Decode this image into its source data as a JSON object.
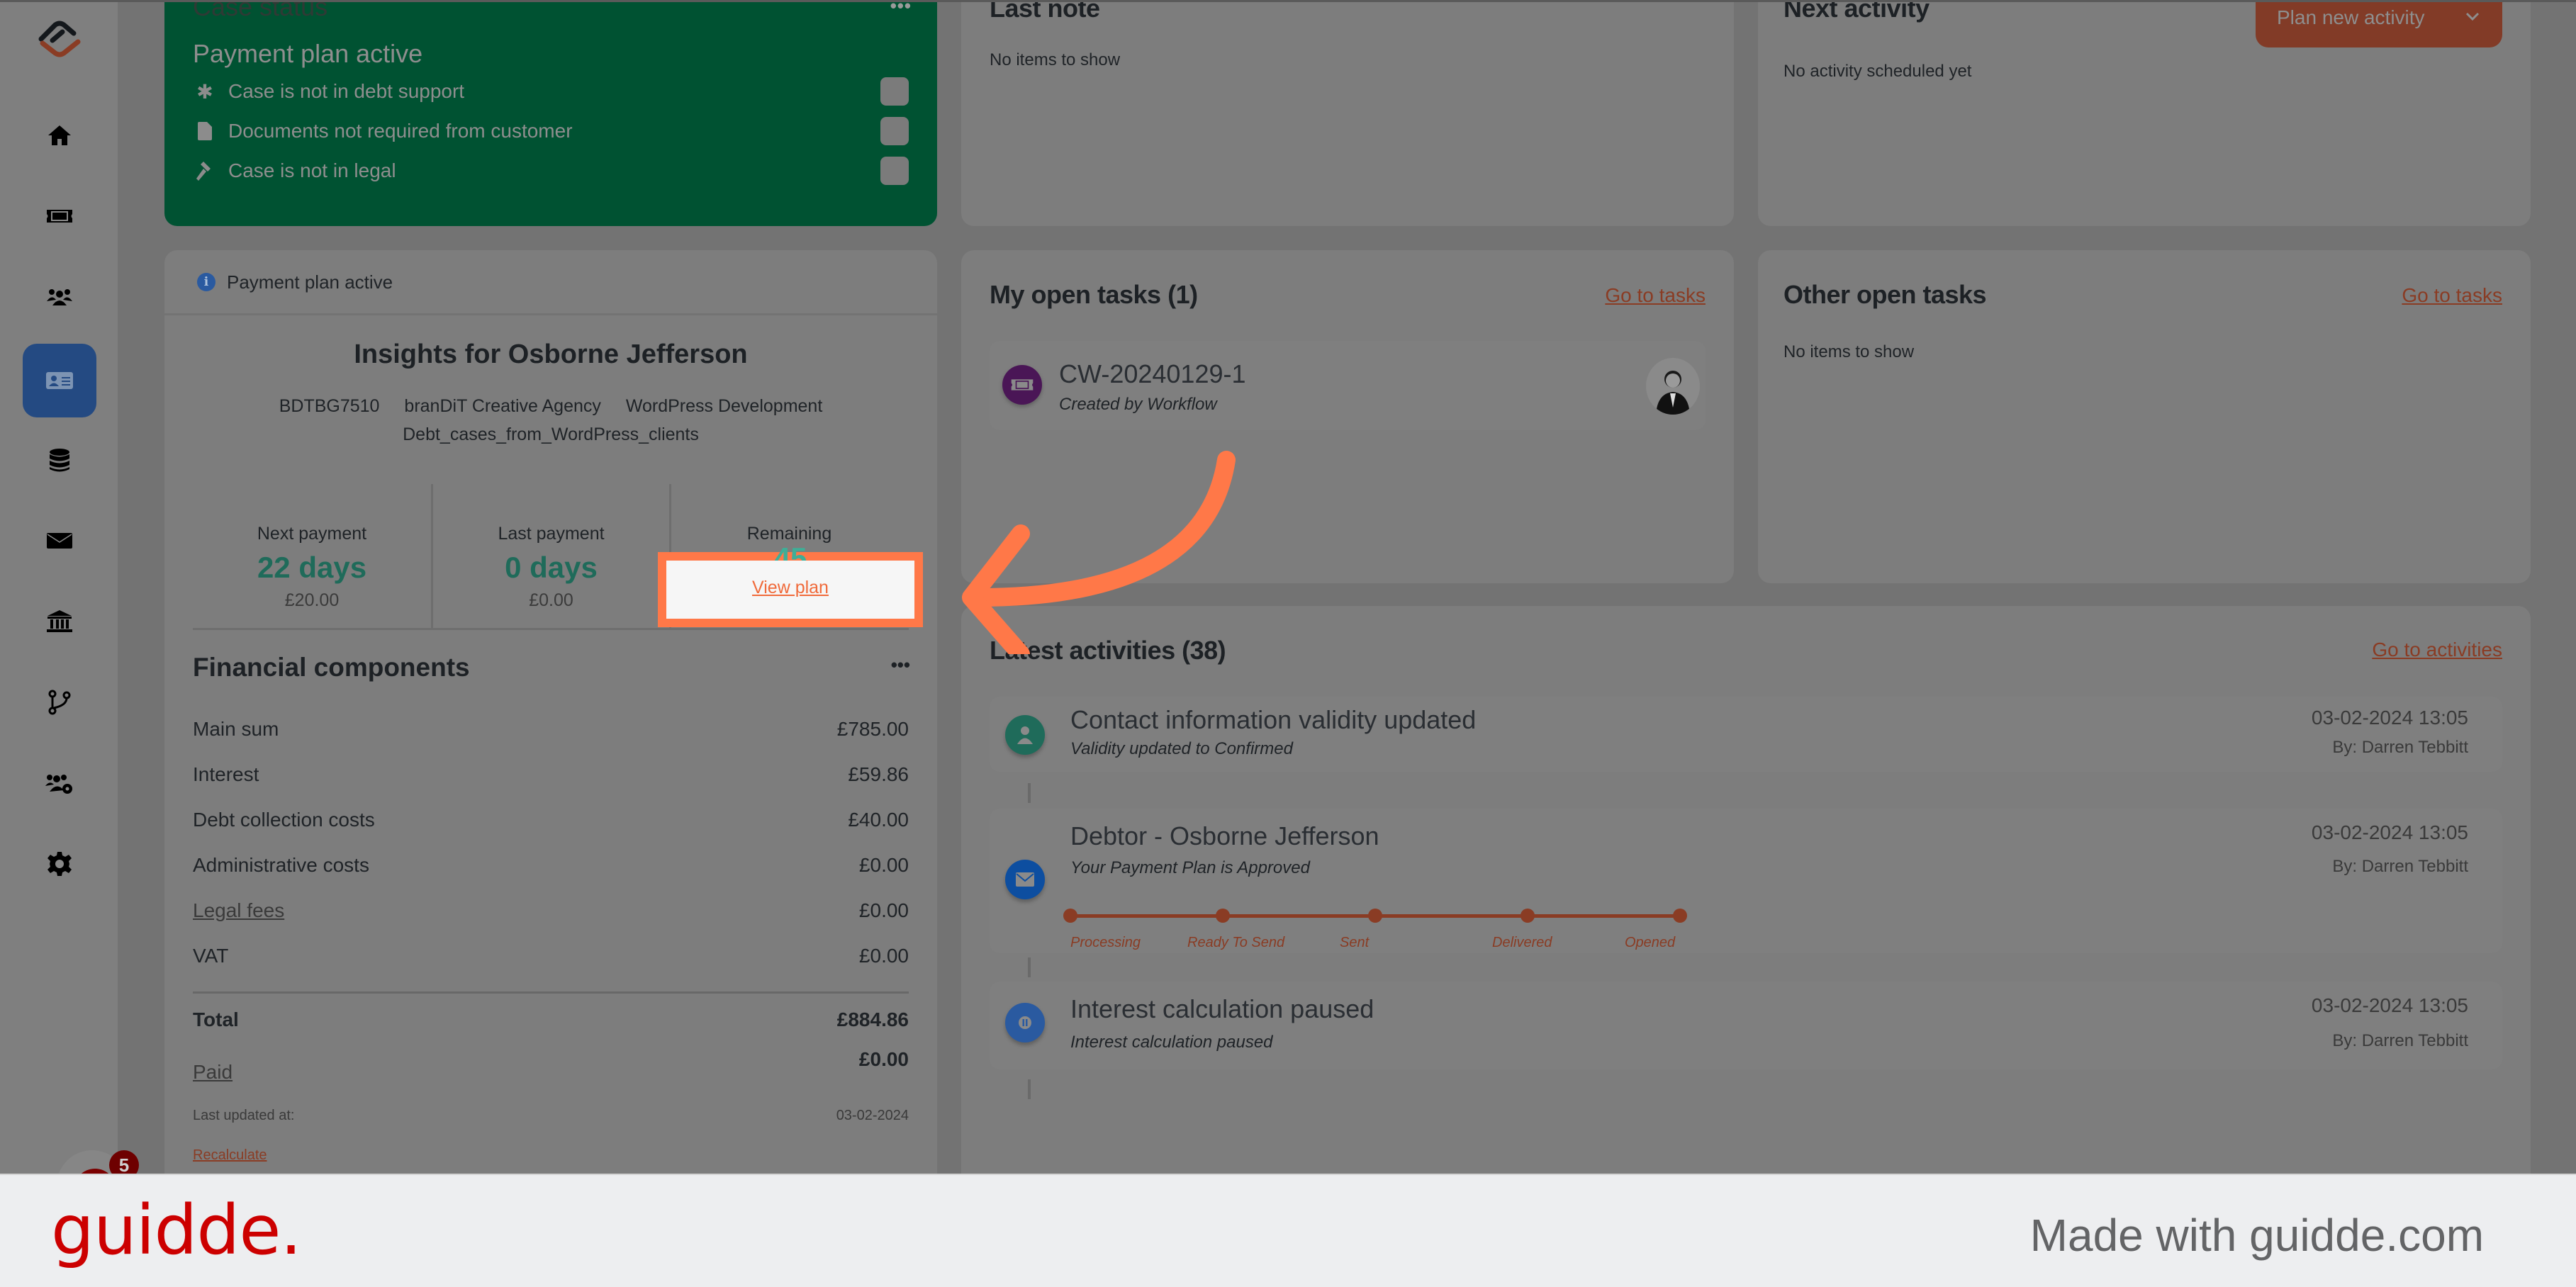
{
  "sidebar": {
    "logo": "app-logo",
    "items": [
      {
        "name": "home",
        "icon": "home-icon",
        "active": false
      },
      {
        "name": "tickets",
        "icon": "ticket-icon",
        "active": false
      },
      {
        "name": "customers",
        "icon": "users-icon",
        "active": false
      },
      {
        "name": "cases",
        "icon": "id-card-icon",
        "active": true
      },
      {
        "name": "database",
        "icon": "database-icon",
        "active": false
      },
      {
        "name": "messages",
        "icon": "envelope-icon",
        "active": false
      },
      {
        "name": "bank",
        "icon": "bank-icon",
        "active": false
      },
      {
        "name": "workflows",
        "icon": "branch-icon",
        "active": false
      },
      {
        "name": "user-groups",
        "icon": "users-gear-icon",
        "active": false
      },
      {
        "name": "settings",
        "icon": "gear-icon",
        "active": false
      }
    ],
    "notification_count": "5"
  },
  "case_status": {
    "title": "Case status",
    "menu": "•••",
    "status": "Payment plan active",
    "rows": [
      {
        "icon": "asterisk-icon",
        "label": "Case is not in debt support"
      },
      {
        "icon": "file-icon",
        "label": "Documents not required from customer"
      },
      {
        "icon": "gavel-icon",
        "label": "Case is not in legal"
      }
    ]
  },
  "insights": {
    "banner": "Payment plan active",
    "title": "Insights for Osborne Jefferson",
    "meta": [
      "BDTBG7510",
      "branDiT Creative Agency",
      "WordPress Development"
    ],
    "meta2": "Debt_cases_from_WordPress_clients",
    "stats": [
      {
        "label": "Next payment",
        "value": "22 days",
        "sub": "£20.00"
      },
      {
        "label": "Last payment",
        "value": "0 days",
        "sub": "£0.00"
      },
      {
        "label": "Remaining",
        "value": "45",
        "link": "View plan"
      }
    ]
  },
  "financial": {
    "title": "Financial components",
    "menu": "•••",
    "rows": [
      {
        "label": "Main sum",
        "value": "£785.00",
        "link": false
      },
      {
        "label": "Interest",
        "value": "£59.86",
        "link": false
      },
      {
        "label": "Debt collection costs",
        "value": "£40.00",
        "link": false
      },
      {
        "label": "Administrative costs",
        "value": "£0.00",
        "link": false
      },
      {
        "label": "Legal fees",
        "value": "£0.00",
        "link": true
      },
      {
        "label": "VAT",
        "value": "£0.00",
        "link": false
      }
    ],
    "total_label": "Total",
    "total_value": "£884.86",
    "paid_label": "Paid",
    "paid_value": "£0.00",
    "updated_label": "Last updated at:",
    "updated_value": "03-02-2024",
    "recalculate": "Recalculate"
  },
  "last_note": {
    "title": "Last note",
    "empty": "No items to show"
  },
  "next_activity": {
    "title": "Next activity",
    "button": "Plan new activity",
    "empty": "No activity scheduled yet"
  },
  "my_tasks": {
    "title": "My open tasks (1)",
    "link": "Go to tasks",
    "items": [
      {
        "id": "CW-20240129-1",
        "sub": "Created by Workflow"
      }
    ]
  },
  "other_tasks": {
    "title": "Other open tasks",
    "link": "Go to tasks",
    "empty": "No items to show"
  },
  "latest": {
    "title": "Latest activities (38)",
    "link": "Go to activities",
    "items": [
      {
        "title": "Contact information validity updated",
        "sub": "Validity updated to Confirmed",
        "date": "03-02-2024 13:05",
        "by": "By: Darren Tebbitt",
        "icon": "user-icon",
        "color": "#1f6b5a"
      },
      {
        "title": "Debtor - Osborne Jefferson",
        "sub": "Your Payment Plan is Approved",
        "date": "03-02-2024 13:05",
        "by": "By: Darren Tebbitt",
        "icon": "envelope-icon",
        "color": "#0d4ea0",
        "steps": [
          "Processing",
          "Ready To Send",
          "Sent",
          "Delivered",
          "Opened"
        ],
        "progress": 1.0
      },
      {
        "title": "Interest calculation paused",
        "sub": "Interest calculation paused",
        "date": "03-02-2024 13:05",
        "by": "By: Darren Tebbitt",
        "icon": "pause-icon",
        "color": "#2a5aa0"
      }
    ]
  },
  "footer": {
    "brand": "guidde.",
    "made_with": "Made with guidde.com"
  },
  "colors": {
    "accent": "#ff7848",
    "brand_red": "#cc0000",
    "status_green": "#005232",
    "nav_active": "#244a82"
  }
}
